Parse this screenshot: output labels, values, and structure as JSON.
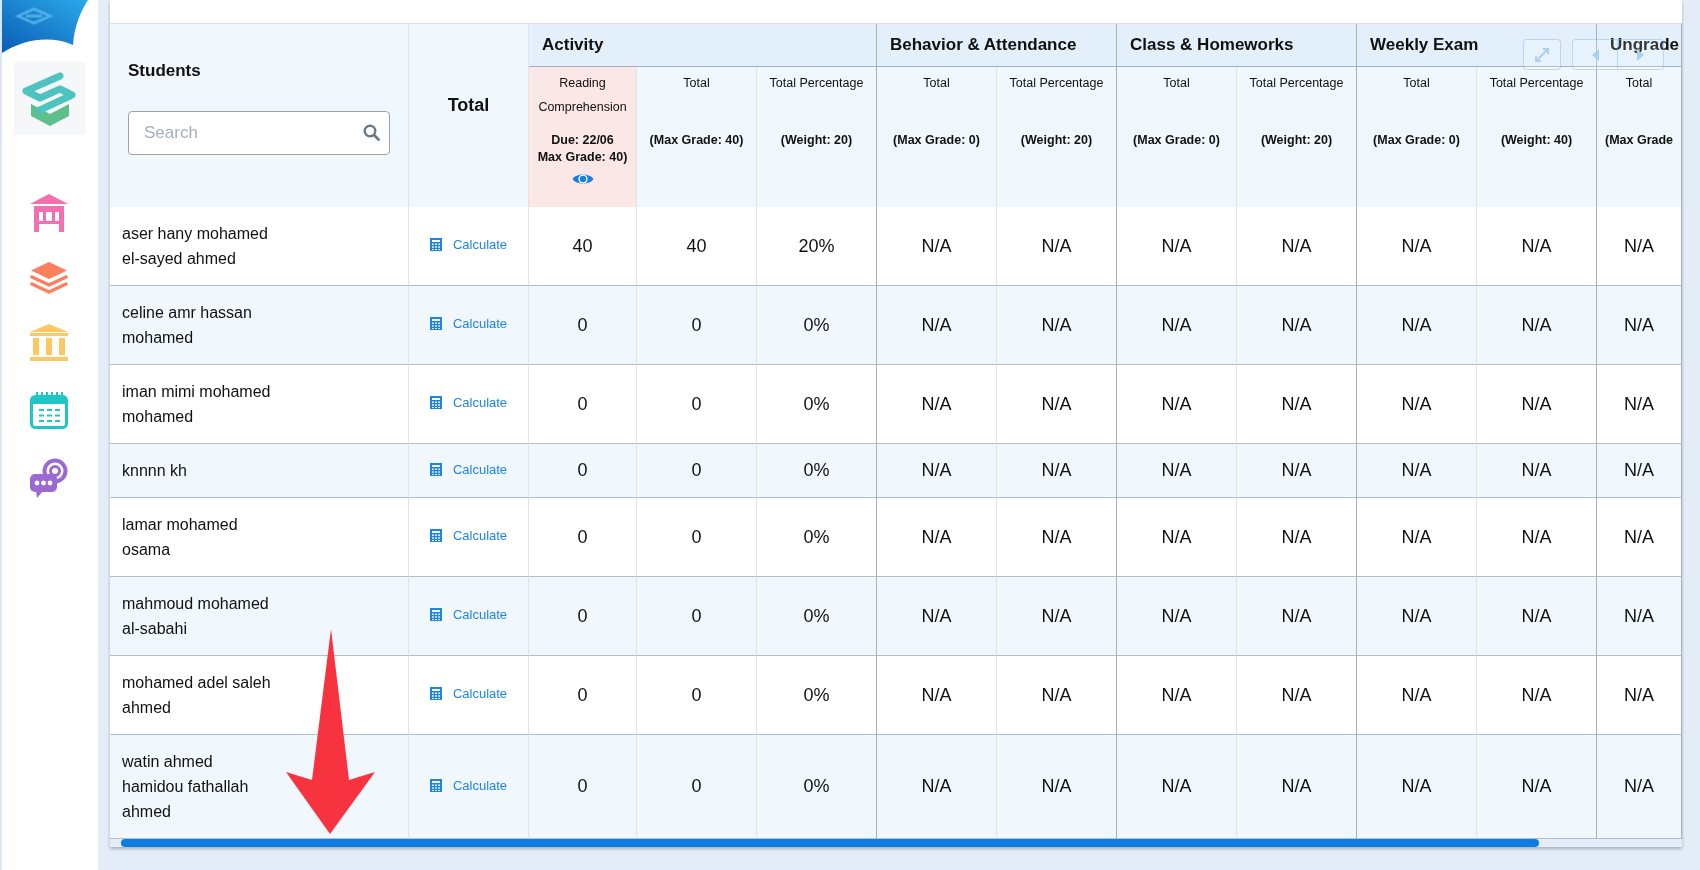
{
  "students_column": {
    "title": "Students",
    "search": {
      "placeholder": "Search"
    }
  },
  "total_column": {
    "title": "Total"
  },
  "groups": [
    {
      "title": "Activity",
      "columns": [
        {
          "kind": "assignment",
          "title": "Reading Comprehension",
          "due": "Due: 22/06",
          "max_grade": "Max Grade: 40)"
        },
        {
          "kind": "summary",
          "title": "Total",
          "meta": "(Max Grade: 40)"
        },
        {
          "kind": "summary",
          "title": "Total Percentage",
          "meta": "(Weight: 20)"
        }
      ]
    },
    {
      "title": "Behavior & Attendance",
      "columns": [
        {
          "kind": "summary",
          "title": "Total",
          "meta": "(Max Grade: 0)"
        },
        {
          "kind": "summary",
          "title": "Total Percentage",
          "meta": "(Weight: 20)"
        }
      ]
    },
    {
      "title": "Class & Homeworks",
      "columns": [
        {
          "kind": "summary",
          "title": "Total",
          "meta": "(Max Grade: 0)"
        },
        {
          "kind": "summary",
          "title": "Total Percentage",
          "meta": "(Weight: 20)"
        }
      ]
    },
    {
      "title": "Weekly Exam",
      "columns": [
        {
          "kind": "summary",
          "title": "Total",
          "meta": "(Max Grade: 0)"
        },
        {
          "kind": "summary",
          "title": "Total Percentage",
          "meta": "(Weight: 40)"
        }
      ]
    },
    {
      "title": "Ungrade",
      "columns": [
        {
          "kind": "summary",
          "title": "Total",
          "meta": "(Max Grade"
        }
      ]
    }
  ],
  "rows": [
    {
      "name": "aser hany mohamed el-sayed ahmed",
      "action": "Calculate",
      "cells": [
        "40",
        "40",
        "20%",
        "N/A",
        "N/A",
        "N/A",
        "N/A",
        "N/A",
        "N/A",
        "N/A"
      ]
    },
    {
      "name": "celine amr hassan mohamed",
      "action": "Calculate",
      "cells": [
        "0",
        "0",
        "0%",
        "N/A",
        "N/A",
        "N/A",
        "N/A",
        "N/A",
        "N/A",
        "N/A"
      ]
    },
    {
      "name": "iman mimi mohamed mohamed",
      "action": "Calculate",
      "cells": [
        "0",
        "0",
        "0%",
        "N/A",
        "N/A",
        "N/A",
        "N/A",
        "N/A",
        "N/A",
        "N/A"
      ]
    },
    {
      "name": "knnnn kh",
      "action": "Calculate",
      "cells": [
        "0",
        "0",
        "0%",
        "N/A",
        "N/A",
        "N/A",
        "N/A",
        "N/A",
        "N/A",
        "N/A"
      ]
    },
    {
      "name": "lamar mohamed osama",
      "action": "Calculate",
      "cells": [
        "0",
        "0",
        "0%",
        "N/A",
        "N/A",
        "N/A",
        "N/A",
        "N/A",
        "N/A",
        "N/A"
      ]
    },
    {
      "name": "mahmoud mohamed al-sabahi",
      "action": "Calculate",
      "cells": [
        "0",
        "0",
        "0%",
        "N/A",
        "N/A",
        "N/A",
        "N/A",
        "N/A",
        "N/A",
        "N/A"
      ]
    },
    {
      "name": "mohamed adel saleh ahmed",
      "action": "Calculate",
      "cells": [
        "0",
        "0",
        "0%",
        "N/A",
        "N/A",
        "N/A",
        "N/A",
        "N/A",
        "N/A",
        "N/A"
      ]
    },
    {
      "name": "watin ahmed hamidou fathallah ahmed",
      "action": "Calculate",
      "cells": [
        "0",
        "0",
        "0%",
        "N/A",
        "N/A",
        "N/A",
        "N/A",
        "N/A",
        "N/A",
        "N/A"
      ]
    }
  ]
}
